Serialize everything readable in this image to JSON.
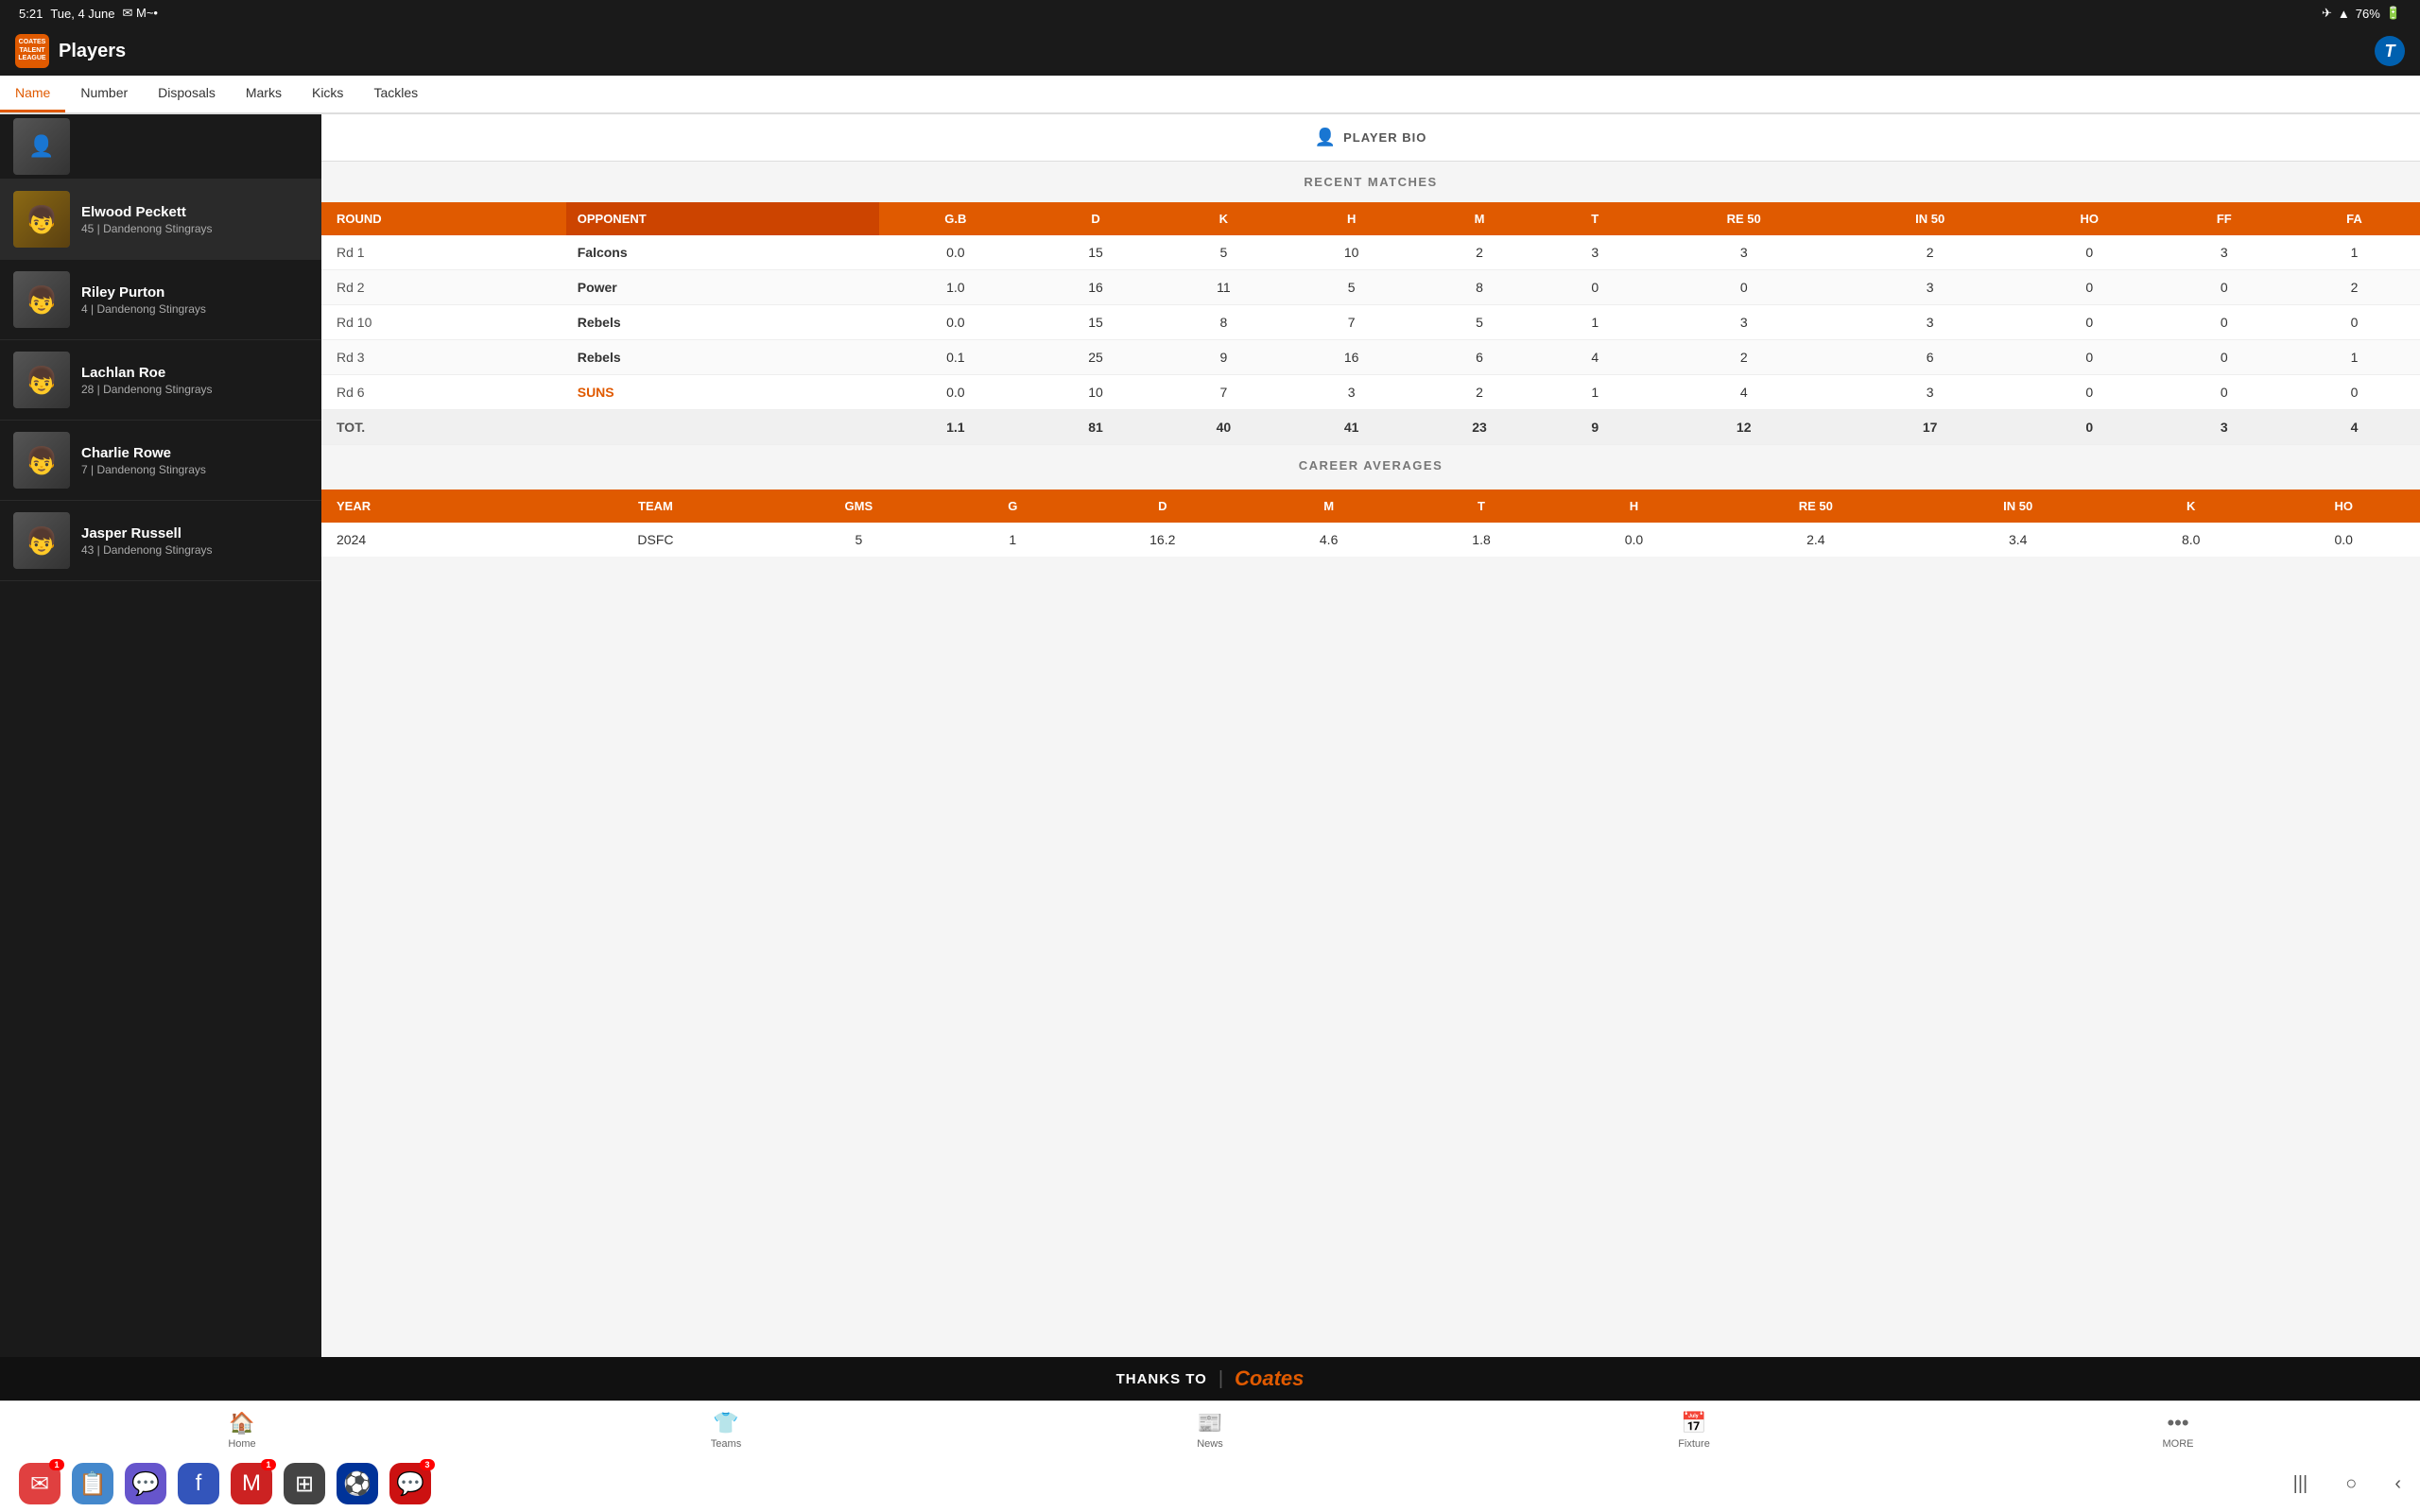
{
  "statusBar": {
    "time": "5:21",
    "date": "Tue, 4 June",
    "emailIcon": "✉",
    "batteryPct": "76%"
  },
  "header": {
    "logoText": "COATES\nTALENT\nLEAGUE",
    "title": "Players",
    "telstraLabel": "T"
  },
  "columnFilters": [
    {
      "label": "Name",
      "active": true
    },
    {
      "label": "Number",
      "active": false
    },
    {
      "label": "Disposals",
      "active": false
    },
    {
      "label": "Marks",
      "active": false
    },
    {
      "label": "Kicks",
      "active": false
    },
    {
      "label": "Tackles",
      "active": false
    }
  ],
  "playerList": [
    {
      "name": "Elwood Peckett",
      "number": "45",
      "team": "Dandenong Stingrays",
      "selected": true
    },
    {
      "name": "Riley Purton",
      "number": "4",
      "team": "Dandenong Stingrays",
      "selected": false
    },
    {
      "name": "Lachlan Roe",
      "number": "28",
      "team": "Dandenong Stingrays",
      "selected": false
    },
    {
      "name": "Charlie Rowe",
      "number": "7",
      "team": "Dandenong Stingrays",
      "selected": false
    },
    {
      "name": "Jasper Russell",
      "number": "43",
      "team": "Dandenong Stingrays",
      "selected": false
    }
  ],
  "playerBio": {
    "label": "PLAYER BIO"
  },
  "recentMatches": {
    "sectionLabel": "RECENT MATCHES",
    "columns": [
      "ROUND",
      "OPPONENT",
      "G.B",
      "D",
      "K",
      "H",
      "M",
      "T",
      "RE 50",
      "IN 50",
      "HO",
      "FF",
      "FA"
    ],
    "rows": [
      {
        "round": "Rd 1",
        "opponent": "Falcons",
        "gb": "0.0",
        "d": "15",
        "k": "5",
        "h": "10",
        "m": "2",
        "t": "3",
        "re50": "3",
        "in50": "2",
        "ho": "0",
        "ff": "3",
        "fa": "1",
        "special": false
      },
      {
        "round": "Rd 2",
        "opponent": "Power",
        "gb": "1.0",
        "d": "16",
        "k": "11",
        "h": "5",
        "m": "8",
        "t": "0",
        "re50": "0",
        "in50": "3",
        "ho": "0",
        "ff": "0",
        "fa": "2",
        "special": false
      },
      {
        "round": "Rd 10",
        "opponent": "Rebels",
        "gb": "0.0",
        "d": "15",
        "k": "8",
        "h": "7",
        "m": "5",
        "t": "1",
        "re50": "3",
        "in50": "3",
        "ho": "0",
        "ff": "0",
        "fa": "0",
        "special": false
      },
      {
        "round": "Rd 3",
        "opponent": "Rebels",
        "gb": "0.1",
        "d": "25",
        "k": "9",
        "h": "16",
        "m": "6",
        "t": "4",
        "re50": "2",
        "in50": "6",
        "ho": "0",
        "ff": "0",
        "fa": "1",
        "special": false
      },
      {
        "round": "Rd 6",
        "opponent": "SUNS",
        "gb": "0.0",
        "d": "10",
        "k": "7",
        "h": "3",
        "m": "2",
        "t": "1",
        "re50": "4",
        "in50": "3",
        "ho": "0",
        "ff": "0",
        "fa": "0",
        "special": true
      }
    ],
    "totals": {
      "round": "TOT.",
      "opponent": "",
      "gb": "1.1",
      "d": "81",
      "k": "40",
      "h": "41",
      "m": "23",
      "t": "9",
      "re50": "12",
      "in50": "17",
      "ho": "0",
      "ff": "3",
      "fa": "4"
    }
  },
  "careerAverages": {
    "sectionLabel": "CAREER AVERAGES",
    "columns": [
      "YEAR",
      "TEAM",
      "GMS",
      "G",
      "D",
      "M",
      "T",
      "H",
      "RE 50",
      "IN 50",
      "K",
      "HO"
    ],
    "rows": [
      {
        "year": "2024",
        "team": "DSFC",
        "gms": "5",
        "g": "1",
        "d": "16.2",
        "m": "4.6",
        "t": "1.8",
        "h": "0.0",
        "re50": "2.4",
        "in50": "3.4",
        "k": "8.0",
        "ho": "0.0"
      }
    ]
  },
  "sponsor": {
    "thanksTo": "THANKS TO",
    "divider": "|",
    "coates": "Coates"
  },
  "bottomNav": [
    {
      "icon": "🏠",
      "label": "Home"
    },
    {
      "icon": "👕",
      "label": "Teams"
    },
    {
      "icon": "📰",
      "label": "News"
    },
    {
      "icon": "📅",
      "label": "Fixture"
    },
    {
      "icon": "•••",
      "label": "MORE"
    }
  ],
  "dockApps": [
    {
      "icon": "✉️",
      "badge": "1",
      "color": "#e04040"
    },
    {
      "icon": "📋",
      "badge": null,
      "color": "#4488cc"
    },
    {
      "icon": "🔵",
      "badge": null,
      "color": "#6655cc"
    },
    {
      "icon": "📘",
      "badge": null,
      "color": "#3355bb"
    },
    {
      "icon": "✉️",
      "badge": "1",
      "color": "#cc2222"
    },
    {
      "icon": "⚏",
      "badge": null,
      "color": "#333"
    },
    {
      "icon": "⚫",
      "badge": null,
      "color": "#111"
    },
    {
      "icon": "🔴",
      "badge": null,
      "color": "#cc1111"
    },
    {
      "icon": "💬",
      "badge": "3",
      "color": "#2266ff"
    }
  ],
  "dockControls": [
    "|||",
    "○",
    "‹"
  ]
}
